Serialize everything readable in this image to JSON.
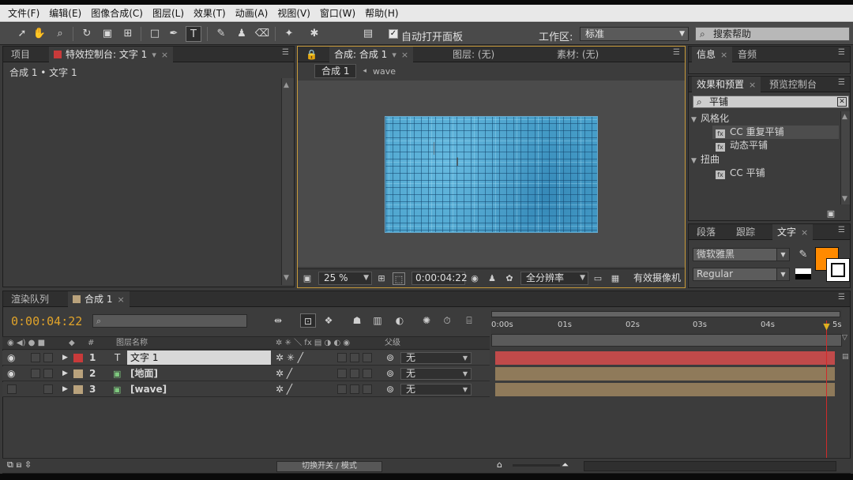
{
  "menu": [
    "文件(F)",
    "编辑(E)",
    "图像合成(C)",
    "图层(L)",
    "效果(T)",
    "动画(A)",
    "视图(V)",
    "窗口(W)",
    "帮助(H)"
  ],
  "toolbar": {
    "auto_open_panel_label": "自动打开面板",
    "auto_open_checked": true,
    "workspace_label": "工作区:",
    "workspace_value": "标准",
    "search_help_placeholder": "搜索帮助"
  },
  "left_panel": {
    "tab_project": "项目",
    "tab_effect_controls": "特效控制台: 文字 1",
    "path": "合成 1 • 文字 1"
  },
  "comp_panel": {
    "tab_comp": "合成: 合成 1",
    "tab_layer": "图层: (无)",
    "tab_footage": "素材: (无)",
    "flow_current": "合成 1",
    "flow_next": "wave",
    "zoom": "25 %",
    "timecode": "0:00:04:22",
    "resolution": "全分辨率",
    "camera": "有效摄像机"
  },
  "right_panel": {
    "tab_info": "信息",
    "tab_audio": "音频",
    "tab_effects_presets": "效果和预置",
    "tab_preview": "预览控制台",
    "effects_search_value": "平铺",
    "effects_tree": [
      {
        "type": "category",
        "label": "风格化"
      },
      {
        "type": "effect",
        "label": "CC 重复平铺",
        "selected": true
      },
      {
        "type": "effect",
        "label": "动态平铺",
        "selected": false
      },
      {
        "type": "category",
        "label": "扭曲"
      },
      {
        "type": "effect",
        "label": "CC 平铺",
        "selected": false
      }
    ],
    "tab_paragraph": "段落",
    "tab_tracker": "跟踪",
    "tab_character": "文字",
    "font_family": "微软雅黑",
    "font_style": "Regular",
    "fill_color": "#ff8a00"
  },
  "timeline": {
    "tab_render_queue": "渲染队列",
    "tab_comp": "合成 1",
    "current_time": "0:00:04:22",
    "col_number": "#",
    "col_layer_name": "图层名称",
    "col_parent": "父级",
    "col_switches": "fx",
    "layers": [
      {
        "num": "1",
        "name": "文字 1",
        "type_icon": "T",
        "color": "#c83a3a",
        "parent": "无",
        "bar_color": "#c04a4a"
      },
      {
        "num": "2",
        "name": "[地面]",
        "type_icon": "comp",
        "color": "#b9a27c",
        "parent": "无",
        "bar_color": "#8f7a5a"
      },
      {
        "num": "3",
        "name": "[wave]",
        "type_icon": "comp",
        "color": "#b9a27c",
        "parent": "无",
        "bar_color": "#8f7a5a"
      }
    ],
    "ruler_ticks": [
      "0:00s",
      "01s",
      "02s",
      "03s",
      "04s",
      "5s"
    ],
    "toggle_label": "切换开关 / 模式"
  }
}
